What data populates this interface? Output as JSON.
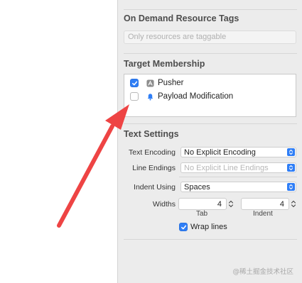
{
  "sections": {
    "on_demand": {
      "title": "On Demand Resource Tags",
      "placeholder": "Only resources are taggable"
    },
    "target_membership": {
      "title": "Target Membership",
      "targets": [
        {
          "label": "Pusher",
          "checked": true,
          "icon": "app-target-icon"
        },
        {
          "label": "Payload Modification",
          "checked": false,
          "icon": "notification-extension-icon"
        }
      ]
    },
    "text_settings": {
      "title": "Text Settings",
      "text_encoding_label": "Text Encoding",
      "text_encoding_value": "No Explicit Encoding",
      "line_endings_label": "Line Endings",
      "line_endings_value": "No Explicit Line Endings",
      "indent_using_label": "Indent Using",
      "indent_using_value": "Spaces",
      "widths_label": "Widths",
      "tab_width": "4",
      "indent_width": "4",
      "tab_label": "Tab",
      "indent_label": "Indent",
      "wrap_lines_label": "Wrap lines",
      "wrap_lines_checked": true
    }
  },
  "watermark": "@稀土掘金技术社区",
  "colors": {
    "accent": "#2f7ef6",
    "annotation_arrow": "#ee4444"
  }
}
